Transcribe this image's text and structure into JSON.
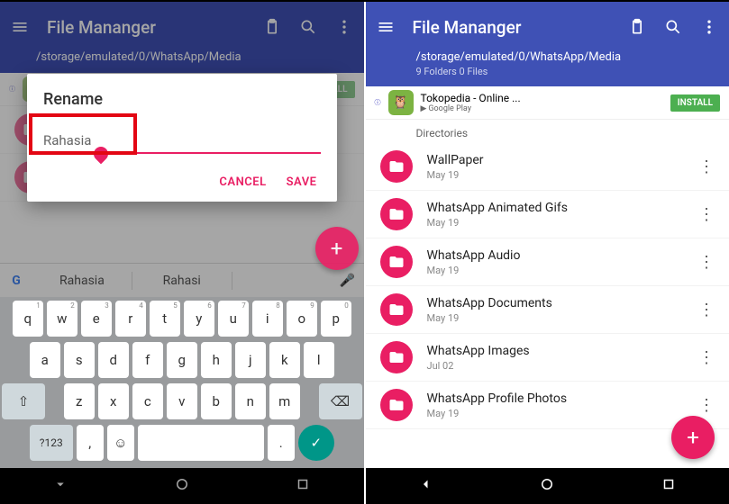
{
  "app": {
    "title": "File Mananger"
  },
  "path": "/storage/emulated/0/WhatsApp/Media",
  "counts": "9 Folders 0 Files",
  "ad": {
    "title": "Tokopedia - Online ...",
    "store": "Google Play",
    "button": "INSTALL"
  },
  "section": "Directories",
  "dialog": {
    "title": "Rename",
    "value": "Rahasia",
    "cancel": "CANCEL",
    "save": "SAVE"
  },
  "suggestions": {
    "s1": "Rahasia",
    "s2": "Rahasi"
  },
  "folders": [
    {
      "name": "WallPaper",
      "date": "May 19"
    },
    {
      "name": "WhatsApp Animated Gifs",
      "date": "May 19"
    },
    {
      "name": "WhatsApp Audio",
      "date": "May 19"
    },
    {
      "name": "WhatsApp Documents",
      "date": "May 19"
    },
    {
      "name": "WhatsApp Images",
      "date": "Jul 02"
    },
    {
      "name": "WhatsApp Profile Photos",
      "date": "May 19"
    }
  ],
  "keys": {
    "r1": [
      "q",
      "w",
      "e",
      "r",
      "t",
      "y",
      "u",
      "i",
      "o",
      "p"
    ],
    "r1n": [
      "1",
      "2",
      "3",
      "4",
      "5",
      "6",
      "7",
      "8",
      "9",
      "0"
    ],
    "r2": [
      "a",
      "s",
      "d",
      "f",
      "g",
      "h",
      "j",
      "k",
      "l"
    ],
    "r3": [
      "z",
      "x",
      "c",
      "v",
      "b",
      "n",
      "m"
    ],
    "sym": "?123",
    "comma": ",",
    "period": "."
  }
}
